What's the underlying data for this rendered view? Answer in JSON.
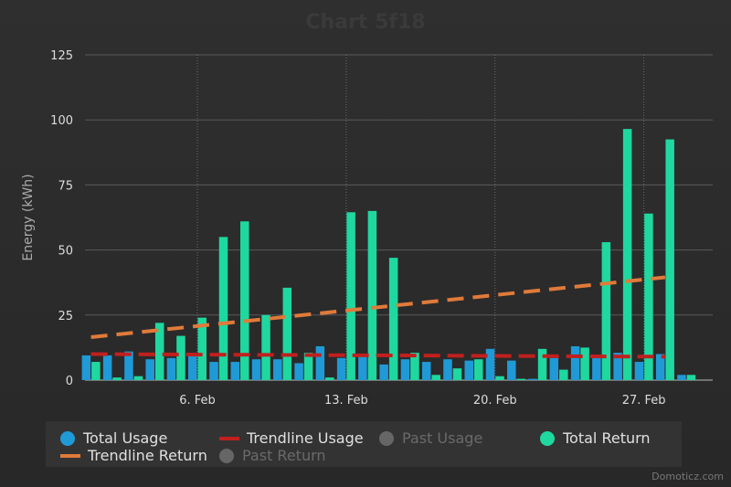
{
  "chart_data": {
    "type": "bar",
    "title": "Chart 5f18",
    "ylabel": "Energy (kWh)",
    "ylim": [
      0,
      125
    ],
    "yticks": [
      0,
      25,
      50,
      75,
      100,
      125
    ],
    "xticks": [
      {
        "day": 6,
        "label": "6. Feb"
      },
      {
        "day": 13,
        "label": "13. Feb"
      },
      {
        "day": 20,
        "label": "20. Feb"
      },
      {
        "day": 27,
        "label": "27. Feb"
      }
    ],
    "days": [
      1,
      2,
      3,
      4,
      5,
      6,
      7,
      8,
      9,
      10,
      11,
      12,
      13,
      14,
      15,
      16,
      17,
      18,
      19,
      20,
      21,
      22,
      23,
      24,
      25,
      26,
      27,
      28,
      29
    ],
    "series": [
      {
        "name": "Total Usage",
        "color": "#1f9ad6",
        "values": [
          9.5,
          9.5,
          11,
          8,
          8.5,
          10,
          7,
          7,
          8,
          8,
          6.5,
          13,
          8.5,
          10,
          6,
          8,
          7,
          8,
          7.5,
          12,
          7.5,
          0.5,
          8.5,
          13,
          8.5,
          10.5,
          7,
          10,
          2
        ]
      },
      {
        "name": "Total Return",
        "color": "#1ed8a0",
        "values": [
          7,
          1,
          1.5,
          22,
          17,
          24,
          55,
          61,
          25,
          35.5,
          10.5,
          1,
          64.5,
          65,
          47,
          10.5,
          2,
          4.5,
          8,
          1.5,
          0.5,
          12,
          4,
          12.5,
          53,
          96.5,
          64,
          92.5,
          2
        ]
      }
    ],
    "trendlines": [
      {
        "name": "Trendline Usage",
        "color": "#c0201e",
        "start": 10,
        "end": 9
      },
      {
        "name": "Trendline Return",
        "color": "#e07a3a",
        "start": 16.5,
        "end": 39.5
      }
    ],
    "legend": [
      {
        "label": "Total Usage",
        "color": "#1f9ad6",
        "kind": "dot",
        "active": true
      },
      {
        "label": "Trendline Usage",
        "color": "#c0201e",
        "kind": "dash",
        "active": true
      },
      {
        "label": "Past Usage",
        "color": "#666666",
        "kind": "dot",
        "active": false
      },
      {
        "label": "Total Return",
        "color": "#1ed8a0",
        "kind": "dot",
        "active": true
      },
      {
        "label": "Trendline Return",
        "color": "#e07a3a",
        "kind": "dash",
        "active": true
      },
      {
        "label": "Past Return",
        "color": "#666666",
        "kind": "dot",
        "active": false
      }
    ]
  },
  "credit": "Domoticz.com"
}
